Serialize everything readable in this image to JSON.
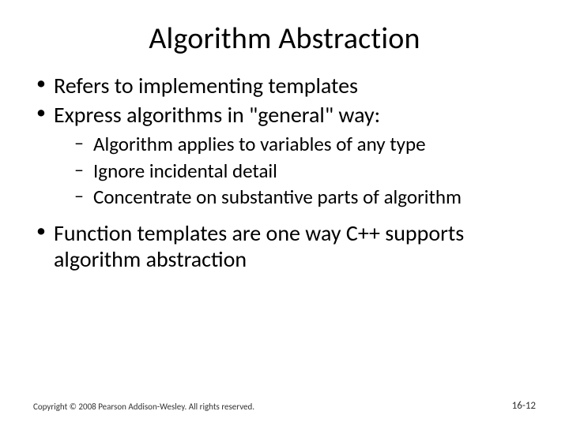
{
  "title": "Algorithm Abstraction",
  "bullets": {
    "b1": "Refers to implementing templates",
    "b2": "Express algorithms in \"general\" way:",
    "b2_sub": {
      "s1": "Algorithm applies to variables of any type",
      "s2": "Ignore incidental detail",
      "s3": "Concentrate on substantive parts of algorithm"
    },
    "b3": "Function templates are one way C++ supports algorithm abstraction"
  },
  "footer": {
    "copyright": "Copyright © 2008 Pearson Addison-Wesley. All rights reserved.",
    "page": "16-12"
  }
}
